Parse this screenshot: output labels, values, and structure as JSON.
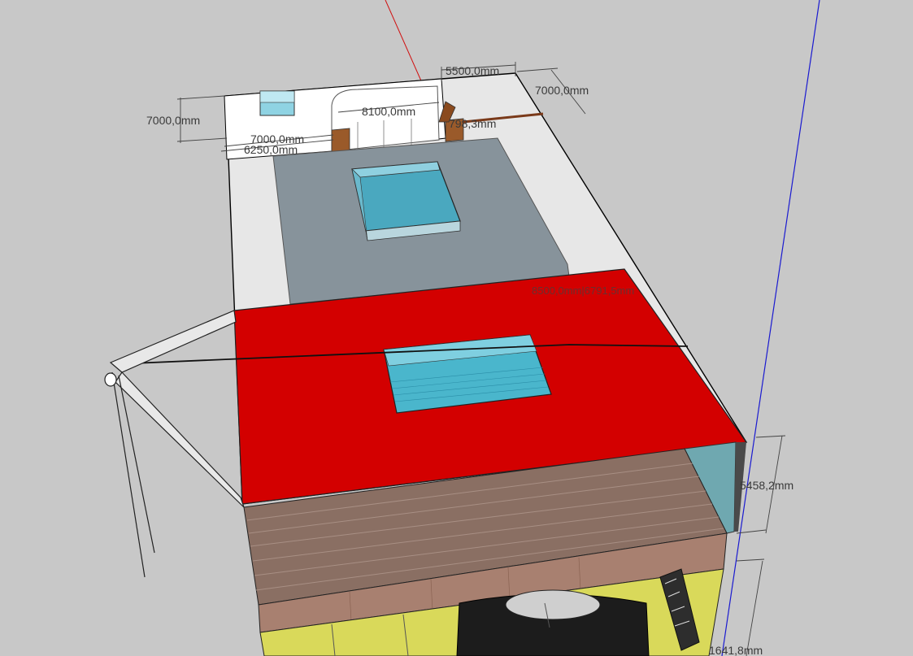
{
  "dimensions": {
    "top_width": "5500,0mm",
    "top_right_depth": "7000,0mm",
    "left_depth": "7000,0mm",
    "inner_width": "8100,0mm",
    "left_lower_a": "7000,0mm",
    "left_lower_b": "6250,0mm",
    "small_right": "798,3mm",
    "mid_label": "8500,0mm|6791,5mm",
    "side_height": "5458,2mm",
    "bottom_height": "1641,8mm"
  },
  "colors": {
    "background": "#c8c8c8",
    "red_roof": "#d30000",
    "glass": "#4ab6cc",
    "deck": "#8a6f63",
    "floor_grey": "#87939b",
    "white_surface": "#ffffff",
    "yellow": "#d9d95a",
    "axis_red": "#d01010",
    "axis_blue": "#1a1ad0"
  }
}
